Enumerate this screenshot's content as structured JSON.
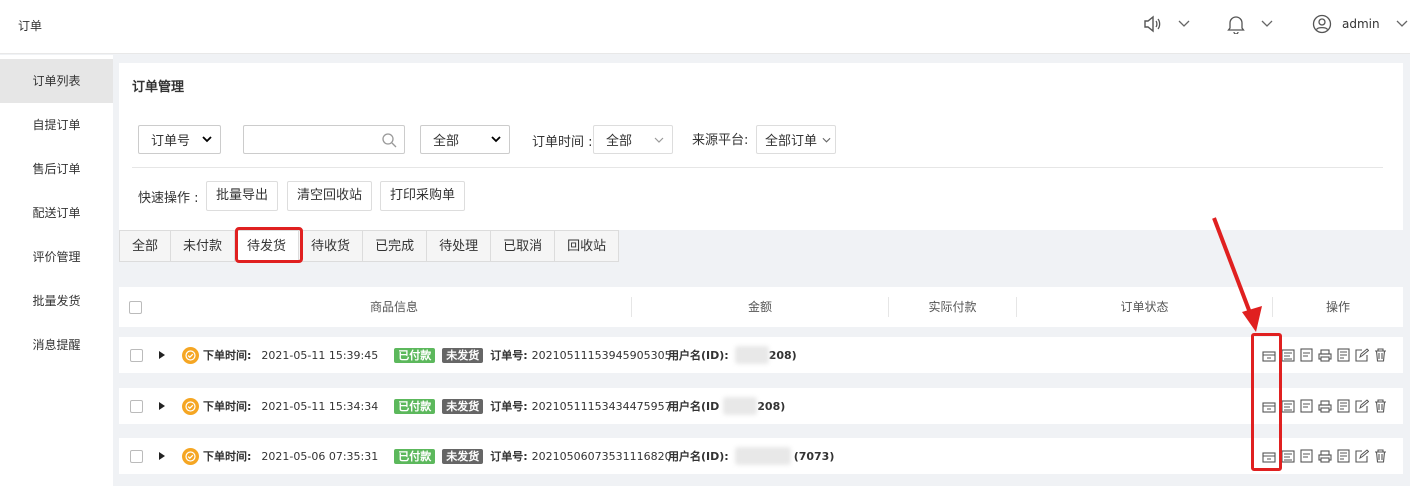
{
  "header": {
    "title": "订单",
    "user": "admin"
  },
  "sidebar": {
    "items": [
      {
        "label": "订单列表"
      },
      {
        "label": "自提订单"
      },
      {
        "label": "售后订单"
      },
      {
        "label": "配送订单"
      },
      {
        "label": "评价管理"
      },
      {
        "label": "批量发货"
      },
      {
        "label": "消息提醒"
      }
    ]
  },
  "panel": {
    "title": "订单管理",
    "order_field": "订单号",
    "status_select": "全部",
    "time_label": "订单时间 :",
    "time_select": "全部",
    "source_label": "来源平台:",
    "source_select": "全部订单",
    "quick_label": "快速操作 :",
    "buttons": [
      "批量导出",
      "清空回收站",
      "打印采购单"
    ]
  },
  "tabs": [
    "全部",
    "未付款",
    "待发货",
    "待收货",
    "已完成",
    "待处理",
    "已取消",
    "回收站"
  ],
  "table": {
    "columns": [
      "商品信息",
      "金额",
      "实际付款",
      "订单状态",
      "操作"
    ],
    "rows": [
      {
        "time_label": "下单时间:",
        "time": "2021-05-11 15:39:45",
        "paid": "已付款",
        "ship": "未发货",
        "order_label": "订单号:",
        "order_no": "20210511153945905305",
        "user_label": "用户名(ID):",
        "user_suffix": "208)"
      },
      {
        "time_label": "下单时间:",
        "time": "2021-05-11 15:34:34",
        "paid": "已付款",
        "ship": "未发货",
        "order_label": "订单号:",
        "order_no": "20210511153434475957",
        "user_label": "用户名(ID",
        "user_suffix": "208)"
      },
      {
        "time_label": "下单时间:",
        "time": "2021-05-06 07:35:31",
        "paid": "已付款",
        "ship": "未发货",
        "order_label": "订单号:",
        "order_no": "20210506073531116820",
        "user_label": "用户名(ID):",
        "user_suffix": "(7073)"
      }
    ]
  },
  "colors": {
    "highlight": "#e02020",
    "paid": "#5cb85c",
    "unshipped": "#666666",
    "time_badge": "#f5a623"
  }
}
